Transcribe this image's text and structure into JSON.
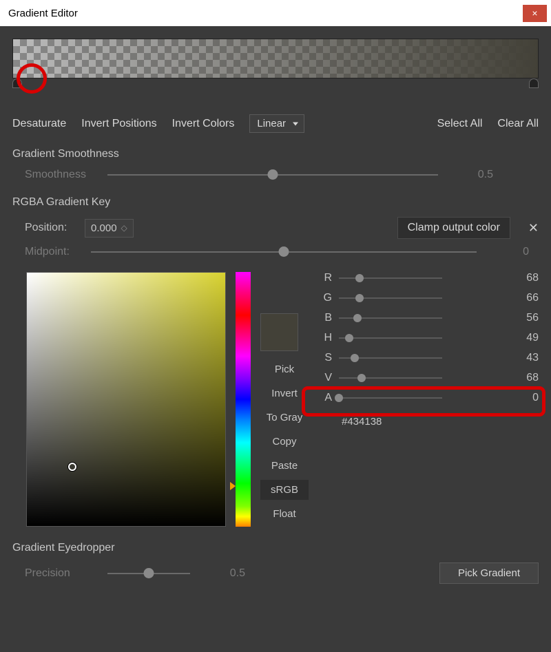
{
  "window": {
    "title": "Gradient Editor"
  },
  "toolbar": {
    "desaturate": "Desaturate",
    "invert_positions": "Invert Positions",
    "invert_colors": "Invert Colors",
    "mode": "Linear",
    "select_all": "Select All",
    "clear_all": "Clear All"
  },
  "smoothness": {
    "heading": "Gradient Smoothness",
    "label": "Smoothness",
    "value": "0.5"
  },
  "key": {
    "heading": "RGBA Gradient Key",
    "position_label": "Position:",
    "position": "0.000",
    "clamp": "Clamp output color",
    "midpoint_label": "Midpoint:",
    "midpoint": "0"
  },
  "actions": {
    "pick": "Pick",
    "invert": "Invert",
    "to_gray": "To Gray",
    "copy": "Copy",
    "paste": "Paste",
    "srgb": "sRGB",
    "float": "Float"
  },
  "channels": {
    "r": {
      "label": "R",
      "value": "68"
    },
    "g": {
      "label": "G",
      "value": "66"
    },
    "b": {
      "label": "B",
      "value": "56"
    },
    "h": {
      "label": "H",
      "value": "49"
    },
    "s": {
      "label": "S",
      "value": "43"
    },
    "v": {
      "label": "V",
      "value": "68"
    },
    "a": {
      "label": "A",
      "value": "0"
    },
    "hex": "#434138"
  },
  "eyedropper": {
    "heading": "Gradient Eyedropper",
    "precision_label": "Precision",
    "precision": "0.5",
    "pick": "Pick Gradient"
  }
}
